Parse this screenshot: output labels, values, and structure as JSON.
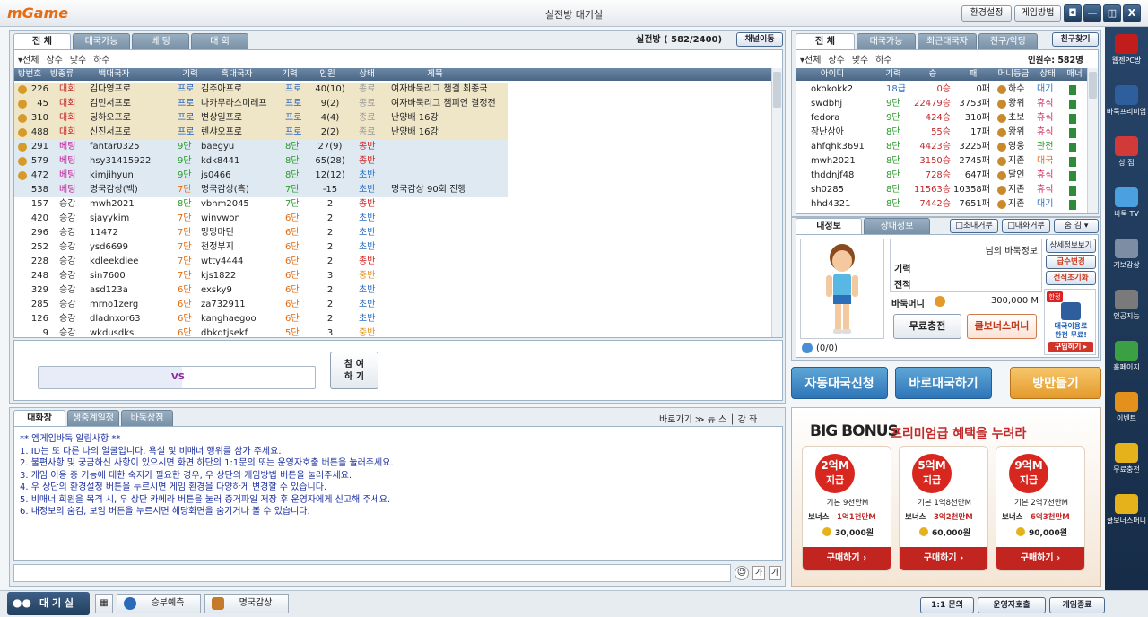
{
  "window": {
    "title": "실전방 대기실",
    "logo": "mGame",
    "settings": "환경설정",
    "howto": "게임방법",
    "cam": "◘",
    "min": "—",
    "max": "◫",
    "close": "X"
  },
  "rooms": {
    "tabs": [
      "전 체",
      "대국가능",
      "베 팅",
      "대 회"
    ],
    "count_label": "실전방 ( 582/2400)",
    "channel_btn": "채널이동",
    "filters": [
      "▾전체",
      "상수",
      "맞수",
      "하수"
    ],
    "columns": [
      "방번호",
      "방종류",
      "백대국자",
      "기력",
      "흑대국자",
      "기력",
      "인원",
      "상태",
      "제목"
    ],
    "rows": [
      {
        "no": "226",
        "type": "대회",
        "white": "김다영프로",
        "wr": "프로",
        "black": "김주아프로",
        "br": "프로",
        "people": "40(10)",
        "state": "종료",
        "title": "여자바둑리그 챔결 최종국",
        "badge": true,
        "bg": "#efe6c8"
      },
      {
        "no": "45",
        "type": "대회",
        "white": "김민서프로",
        "wr": "프로",
        "black": "나카무라스미레프",
        "br": "프로",
        "people": "9(2)",
        "state": "종료",
        "title": "여자바둑리그 챔피언 결정전",
        "badge": true,
        "bg": "#efe6c8"
      },
      {
        "no": "310",
        "type": "대회",
        "white": "딩하오프로",
        "wr": "프로",
        "black": "변상일프로",
        "br": "프로",
        "people": "4(4)",
        "state": "종료",
        "title": "난양배 16강",
        "badge": true,
        "bg": "#efe6c8"
      },
      {
        "no": "488",
        "type": "대회",
        "white": "신진서프로",
        "wr": "프로",
        "black": "렌샤오프로",
        "br": "프로",
        "people": "2(2)",
        "state": "종료",
        "title": "난양배 16강",
        "badge": true,
        "bg": "#efe6c8"
      },
      {
        "no": "291",
        "type": "베팅",
        "white": "fantar0325",
        "wr": "9단",
        "black": "baegyu",
        "br": "8단",
        "people": "27(9)",
        "state": "종반",
        "title": "",
        "badge": true,
        "bg": "#dfe9f2"
      },
      {
        "no": "579",
        "type": "베팅",
        "white": "hsy31415922",
        "wr": "9단",
        "black": "kdk8441",
        "br": "8단",
        "people": "65(28)",
        "state": "종반",
        "title": "",
        "badge": true,
        "bg": "#dfe9f2"
      },
      {
        "no": "472",
        "type": "베팅",
        "white": "kimjihyun",
        "wr": "9단",
        "black": "js0466",
        "br": "8단",
        "people": "12(12)",
        "state": "초반",
        "title": "",
        "badge": true,
        "bg": "#dfe9f2"
      },
      {
        "no": "538",
        "type": "베팅",
        "white": "명국감상(백)",
        "wr": "7단",
        "black": "명국감상(흑)",
        "br": "7단",
        "people": "-15",
        "state": "초반",
        "title": "명국감상 90회 진행",
        "badge": false,
        "bg": "#dfe9f2"
      },
      {
        "no": "157",
        "type": "승강",
        "white": "mwh2021",
        "wr": "8단",
        "black": "vbnm2045",
        "br": "7단",
        "people": "2",
        "state": "종반",
        "title": "",
        "badge": false,
        "bg": ""
      },
      {
        "no": "420",
        "type": "승강",
        "white": "sjayykim",
        "wr": "7단",
        "black": "winvwon",
        "br": "6단",
        "people": "2",
        "state": "초반",
        "title": "",
        "badge": false,
        "bg": ""
      },
      {
        "no": "296",
        "type": "승강",
        "white": "11472",
        "wr": "7단",
        "black": "망망마틴",
        "br": "6단",
        "people": "2",
        "state": "초반",
        "title": "",
        "badge": false,
        "bg": ""
      },
      {
        "no": "252",
        "type": "승강",
        "white": "ysd6699",
        "wr": "7단",
        "black": "천정부지",
        "br": "6단",
        "people": "2",
        "state": "초반",
        "title": "",
        "badge": false,
        "bg": ""
      },
      {
        "no": "228",
        "type": "승강",
        "white": "kdleekdlee",
        "wr": "7단",
        "black": "wtty4444",
        "br": "6단",
        "people": "2",
        "state": "종반",
        "title": "",
        "badge": false,
        "bg": ""
      },
      {
        "no": "248",
        "type": "승강",
        "white": "sin7600",
        "wr": "7단",
        "black": "kjs1822",
        "br": "6단",
        "people": "3",
        "state": "중반",
        "title": "",
        "badge": false,
        "bg": ""
      },
      {
        "no": "329",
        "type": "승강",
        "white": "asd123a",
        "wr": "6단",
        "black": "exsky9",
        "br": "6단",
        "people": "2",
        "state": "초반",
        "title": "",
        "badge": false,
        "bg": ""
      },
      {
        "no": "285",
        "type": "승강",
        "white": "mrno1zerg",
        "wr": "6단",
        "black": "za732911",
        "br": "6단",
        "people": "2",
        "state": "초반",
        "title": "",
        "badge": false,
        "bg": ""
      },
      {
        "no": "126",
        "type": "승강",
        "white": "dladnxor63",
        "wr": "6단",
        "black": "kanghaegoo",
        "br": "6단",
        "people": "2",
        "state": "초반",
        "title": "",
        "badge": false,
        "bg": ""
      },
      {
        "no": "9",
        "type": "승강",
        "white": "wkdusdks",
        "wr": "6단",
        "black": "dbkdtjsekf",
        "br": "5단",
        "people": "3",
        "state": "중반",
        "title": "",
        "badge": false,
        "bg": ""
      }
    ],
    "vs": "VS",
    "join": "참 여\n하 기"
  },
  "users": {
    "tabs": [
      "전 체",
      "대국가능",
      "최근대국자",
      "친구/악당"
    ],
    "find_friend": "친구찾기",
    "filters": [
      "▾전체",
      "상수",
      "맞수",
      "하수"
    ],
    "count_label": "인원수: 582명",
    "columns": [
      "아이디",
      "기력",
      "승",
      "패",
      "머니등급",
      "상태",
      "매너"
    ],
    "rows": [
      {
        "id": "okokokk2",
        "rank": "18급",
        "win": "0승",
        "loss": "0패",
        "grade": "하수",
        "state": "대기",
        "sc": "#2a6fc1"
      },
      {
        "id": "swdbhj",
        "rank": "9단",
        "win": "22479승",
        "loss": "3753패",
        "grade": "왕위",
        "state": "휴식",
        "sc": "#d0245a"
      },
      {
        "id": "fedora",
        "rank": "9단",
        "win": "424승",
        "loss": "310패",
        "grade": "초보",
        "state": "휴식",
        "sc": "#d0245a"
      },
      {
        "id": "장난삼아",
        "rank": "8단",
        "win": "55승",
        "loss": "17패",
        "grade": "왕위",
        "state": "휴식",
        "sc": "#d0245a"
      },
      {
        "id": "ahfqhk3691",
        "rank": "8단",
        "win": "4423승",
        "loss": "3225패",
        "grade": "영웅",
        "state": "관전",
        "sc": "#2a9a2a"
      },
      {
        "id": "mwh2021",
        "rank": "8단",
        "win": "3150승",
        "loss": "2745패",
        "grade": "지존",
        "state": "대국",
        "sc": "#e06a10"
      },
      {
        "id": "thddnjf48",
        "rank": "8단",
        "win": "728승",
        "loss": "647패",
        "grade": "달인",
        "state": "휴식",
        "sc": "#d0245a"
      },
      {
        "id": "sh0285",
        "rank": "8단",
        "win": "11563승",
        "loss": "10358패",
        "grade": "지존",
        "state": "휴식",
        "sc": "#d0245a"
      },
      {
        "id": "hhd4321",
        "rank": "8단",
        "win": "7442승",
        "loss": "7651패",
        "grade": "지존",
        "state": "대기",
        "sc": "#2a6fc1"
      }
    ]
  },
  "profile": {
    "tabs": [
      "내정보",
      "상대정보"
    ],
    "invite_block": "□초대거부",
    "chat_block": "□대화거부",
    "hide": "숨 김 ▾",
    "heading": "님의 바둑정보",
    "detail_btn": "상세정보보기",
    "rank_label": "기력",
    "record_label": "전적",
    "rank_change": "급수변경",
    "reset": "전적초기화",
    "money_label": "바둑머니",
    "money_value": "300,000 M",
    "free_charge": "무료충전",
    "bonus_money": "쿨보너스머니",
    "ad_badge": "한정",
    "ad_text": "대국이용료\n완전 무료!",
    "ad_buy": "구입하기 ▸",
    "counter": "(0/0)"
  },
  "actions": {
    "auto": "자동대국신청",
    "direct": "바로대국하기",
    "create": "방만들기"
  },
  "chat": {
    "tabs": [
      "대화창",
      "생중계일정",
      "바둑상점"
    ],
    "links": "바로가기 ≫ 뉴 스 │ 강 좌",
    "lines": [
      "** 엠게임바둑 알림사항 **",
      "1. ID는 또 다른 나의 얼굴입니다. 욕설 및 비매너 행위를 삼가 주세요.",
      "2. 불편사항 및 궁금하신 사항이 있으시면 화면 하단의 1:1문의 또는 운영자호출 버튼을 눌러주세요.",
      "3. 게임 이용 중 기능에 대한 숙지가 필요한 경우, 우 상단의 게임방법 버튼을 눌러주세요.",
      "4. 우 상단의 환경설정 버튼을 누르시면 게임 환경을 다양하게 변경할 수 있습니다.",
      "5. 비매너 회원을 목격 시, 우 상단 카메라 버튼을 눌러 증거파일 저장 후 운영자에게 신고해 주세요.",
      "6. 내정보의 숨김, 보임 버튼을 누르시면 해당화면을 숨기거나 볼 수 있습니다."
    ],
    "emoji": "☺",
    "font": "가",
    "translate": "가"
  },
  "promo": {
    "title_en": "BIG BONUS",
    "title_kr": "프리미엄급 혜택을 누려라",
    "cards": [
      {
        "amount": "2억M",
        "tag": "지급",
        "base": "기본 9천만M",
        "bonus_label": "보너스",
        "bonus": "1억1천만M",
        "price": "30,000원",
        "buy": "구매하기 ›"
      },
      {
        "amount": "5억M",
        "tag": "지급",
        "base": "기본 1억8천만M",
        "bonus_label": "보너스",
        "bonus": "3억2천만M",
        "price": "60,000원",
        "buy": "구매하기 ›"
      },
      {
        "amount": "9억M",
        "tag": "지급",
        "base": "기본 2억7천만M",
        "bonus_label": "보너스",
        "bonus": "6억3천만M",
        "price": "90,000원",
        "buy": "구매하기 ›"
      }
    ]
  },
  "sidebar": [
    {
      "label": "웹젠PC방",
      "color": "#c21d1d"
    },
    {
      "label": "바둑프리미엄",
      "color": "#2e5e9c"
    },
    {
      "label": "상 점",
      "color": "#d23a3a"
    },
    {
      "label": "바둑 TV",
      "color": "#4ba1e0"
    },
    {
      "label": "기보감상",
      "color": "#7d8ea4"
    },
    {
      "label": "인공지능",
      "color": "#7a7a7a"
    },
    {
      "label": "홈페이지",
      "color": "#3aa043"
    },
    {
      "label": "이벤트",
      "color": "#e3901c"
    },
    {
      "label": "무료충전",
      "color": "#e6b21c"
    },
    {
      "label": "쿨보너스머니",
      "color": "#e6b21c"
    }
  ],
  "bottom": {
    "lobby": "대 기 실",
    "predict": "승부예측",
    "replay": "명국감상",
    "inquiry": "1:1 문의",
    "call": "운영자호출",
    "exit": "게임종료"
  }
}
